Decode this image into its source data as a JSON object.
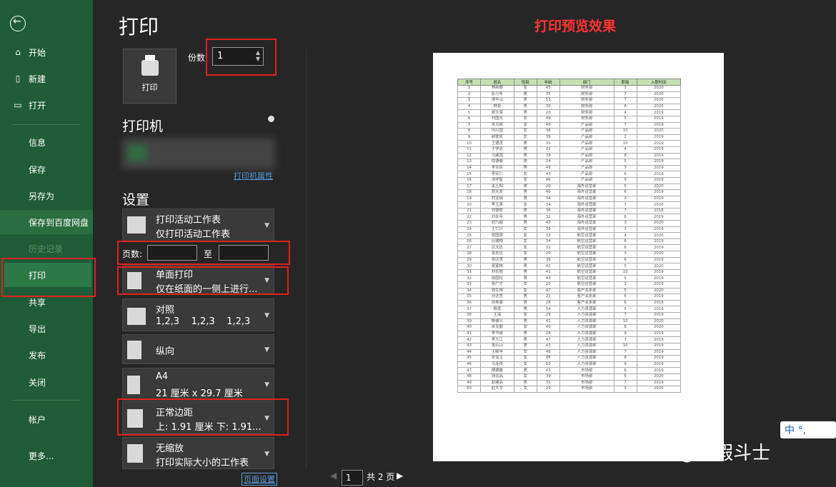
{
  "sidebar": {
    "items": [
      {
        "icon": "home-icon",
        "label": "开始"
      },
      {
        "icon": "new-doc-icon",
        "label": "新建"
      },
      {
        "icon": "open-folder-icon",
        "label": "打开"
      }
    ],
    "plain": [
      "信息",
      "保存",
      "另存为",
      "保存到百度网盘",
      "历史记录",
      "打印",
      "共享",
      "导出",
      "发布",
      "关闭",
      "帐户",
      "更多..."
    ]
  },
  "print": {
    "title": "打印",
    "print_button": "打印",
    "copies_label": "份数:",
    "copies_value": "1",
    "printer_section": "打印机",
    "printer_props_link": "打印机属性",
    "settings_section": "设置",
    "options": [
      {
        "l1": "打印活动工作表",
        "l2": "仅打印活动工作表"
      },
      {
        "l1": "单面打印",
        "l2": "仅在纸面的一侧上进行..."
      },
      {
        "l1": "对照",
        "l2": "1,2,3    1,2,3    1,2,3"
      },
      {
        "l1": "纵向",
        "l2": ""
      },
      {
        "l1": "A4",
        "l2": "21 厘米 x 29.7 厘米"
      },
      {
        "l1": "正常边距",
        "l2": "上: 1.91 厘米 下: 1.91..."
      },
      {
        "l1": "无缩放",
        "l2": "打印实际大小的工作表"
      }
    ],
    "pages_label": "页数:",
    "to_label": "至",
    "page_setup_link": "页面设置"
  },
  "preview": {
    "caption": "打印预览效果",
    "current_page": "1",
    "total_pages": "共 2 页"
  },
  "sheet": {
    "headers": [
      "序号",
      "姓名",
      "性别",
      "年龄",
      "部门",
      "职级",
      "入职时间"
    ],
    "rows": [
      [
        "1",
        "林新娜",
        "女",
        "45",
        "财务部",
        "3",
        "2020"
      ],
      [
        "2",
        "彭万年",
        "男",
        "35",
        "财务部",
        "7",
        "2020"
      ],
      [
        "3",
        "谭辛山",
        "男",
        "53",
        "财务部",
        "7",
        "2020"
      ],
      [
        "4",
        "林景",
        "男",
        "30",
        "财务部",
        "8",
        "2020"
      ],
      [
        "5",
        "谢大海",
        "男",
        "20",
        "财务部",
        "4",
        "2019"
      ],
      [
        "6",
        "刘国光",
        "女",
        "49",
        "财务部",
        "5",
        "2019"
      ],
      [
        "7",
        "吴克俭",
        "女",
        "40",
        "产品部",
        "7",
        "2019"
      ],
      [
        "8",
        "冯兴国",
        "女",
        "38",
        "产品部",
        "10",
        "2020"
      ],
      [
        "9",
        "郝爱民",
        "女",
        "39",
        "产品部",
        "2",
        "2019"
      ],
      [
        "10",
        "王德茂",
        "男",
        "31",
        "产品部",
        "10",
        "2019"
      ],
      [
        "11",
        "于学忠",
        "男",
        "22",
        "产品部",
        "4",
        "2019"
      ],
      [
        "12",
        "马建国",
        "男",
        "39",
        "产品部",
        "8",
        "2019"
      ],
      [
        "13",
        "倪德春",
        "男",
        "24",
        "产品部",
        "5",
        "2019"
      ],
      [
        "14",
        "李安民",
        "男",
        "49",
        "产品部",
        "3",
        "2019"
      ],
      [
        "15",
        "李宏仁",
        "女",
        "43",
        "产品部",
        "6",
        "2019"
      ],
      [
        "16",
        "汤学智",
        "女",
        "46",
        "产品部",
        "9",
        "2019"
      ],
      [
        "17",
        "关玉和",
        "男",
        "20",
        "海外运营部",
        "5",
        "2020"
      ],
      [
        "18",
        "贾无发",
        "男",
        "46",
        "海外运营部",
        "6",
        "2019"
      ],
      [
        "19",
        "刘宝瑞",
        "男",
        "34",
        "海外运营部",
        "3",
        "2019"
      ],
      [
        "20",
        "李玉泉",
        "女",
        "34",
        "海外运营部",
        "7",
        "2020"
      ],
      [
        "21",
        "刘德财",
        "男",
        "36",
        "海外运营部",
        "7",
        "2018"
      ],
      [
        "22",
        "刘永年",
        "男",
        "32",
        "海外运营部",
        "6",
        "2019"
      ],
      [
        "23",
        "刘乃超",
        "男",
        "43",
        "海外运营部",
        "3",
        "2020"
      ],
      [
        "24",
        "王仁兴",
        "女",
        "39",
        "海外运营部",
        "3",
        "2019"
      ],
      [
        "25",
        "吴国梁",
        "女",
        "33",
        "航空运营部",
        "4",
        "2020"
      ],
      [
        "26",
        "吕德榜",
        "女",
        "34",
        "航空运营部",
        "6",
        "2019"
      ],
      [
        "27",
        "吕文达",
        "女",
        "32",
        "航空运营部",
        "6",
        "2019"
      ],
      [
        "28",
        "张志远",
        "女",
        "20",
        "航空运营部",
        "3",
        "2020"
      ],
      [
        "29",
        "张庆思",
        "男",
        "36",
        "航空运营部",
        "6",
        "2019"
      ],
      [
        "30",
        "吴家栋",
        "男",
        "42",
        "航空运营部",
        "5",
        "2020"
      ],
      [
        "31",
        "刘长胜",
        "男",
        "41",
        "航空运营部",
        "10",
        "2019"
      ],
      [
        "32",
        "徐国柱",
        "男",
        "43",
        "航空运营部",
        "5",
        "2019"
      ],
      [
        "33",
        "张广才",
        "女",
        "20",
        "航空运营部",
        "3",
        "2019"
      ],
      [
        "34",
        "钱生禄",
        "女",
        "47",
        "客户关系部",
        "5",
        "2020"
      ],
      [
        "35",
        "孙达言",
        "男",
        "22",
        "客户关系部",
        "6",
        "2019"
      ],
      [
        "36",
        "孙寿康",
        "男",
        "28",
        "客户关系部",
        "6",
        "2019"
      ],
      [
        "37",
        "杨勇",
        "男",
        "54",
        "人力资源部",
        "5",
        "2019"
      ],
      [
        "38",
        "王海",
        "女",
        "29",
        "人力资源部",
        "7",
        "2019"
      ],
      [
        "39",
        "杨德义",
        "男",
        "41",
        "人力资源部",
        "10",
        "2020"
      ],
      [
        "40",
        "余克勤",
        "女",
        "40",
        "人力资源部",
        "8",
        "2020"
      ],
      [
        "41",
        "李书诚",
        "男",
        "28",
        "人力资源部",
        "9",
        "2019"
      ],
      [
        "42",
        "李大江",
        "男",
        "47",
        "人力资源部",
        "7",
        "2019"
      ],
      [
        "43",
        "张石山",
        "男",
        "43",
        "人力资源部",
        "10",
        "2019"
      ],
      [
        "44",
        "王殿甲",
        "女",
        "46",
        "人力资源部",
        "7",
        "2019"
      ],
      [
        "45",
        "吴宝玉",
        "女",
        "48",
        "人力资源部",
        "8",
        "2019"
      ],
      [
        "46",
        "马连良",
        "女",
        "50",
        "人力资源部",
        "9",
        "2019"
      ],
      [
        "47",
        "傅德春",
        "男",
        "43",
        "市场部",
        "6",
        "2019"
      ],
      [
        "48",
        "钱远高",
        "女",
        "39",
        "市场部",
        "6",
        "2020"
      ],
      [
        "49",
        "赵建高",
        "男",
        "31",
        "市场部",
        "7",
        "2019"
      ],
      [
        "50",
        "赵大宇",
        "女",
        "29",
        "市场部",
        "3",
        "2020"
      ]
    ]
  },
  "overlay": {
    "watermark": "知乎 @真假斗士",
    "ime": "中 °,"
  },
  "colors": {
    "sidebar": "#1f5c37",
    "selected": "#2d7a46",
    "highlight": "#e02020",
    "table_header": "#c6e0b4"
  }
}
